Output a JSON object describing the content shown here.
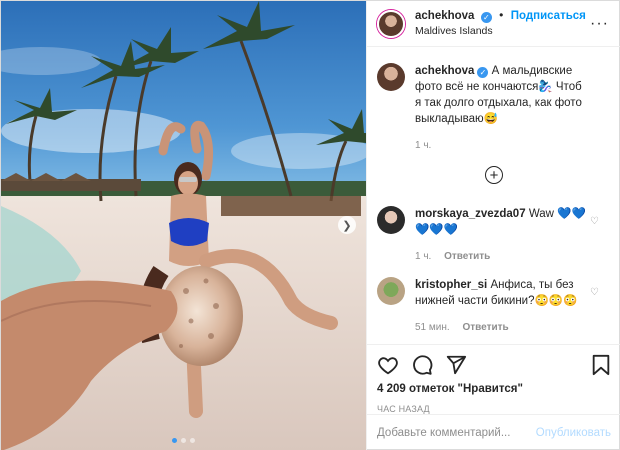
{
  "post": {
    "username": "achekhova",
    "follow_label": "Подписаться",
    "location": "Maldives Islands"
  },
  "caption": {
    "username": "achekhova",
    "text": "А мальдивские фото всё не кончаются🧞‍♀️ Чтоб я так долго отдыхала, как фото выкладываю😅",
    "time": "1 ч."
  },
  "comments": [
    {
      "username": "morskaya_zvezda07",
      "text": "Waw 💙💙💙💙💙",
      "time": "1 ч.",
      "reply_label": "Ответить"
    },
    {
      "username": "kristopher_si",
      "text": "Анфиса, ты без нижней части бикини?😳😳😳",
      "time": "51 мин.",
      "reply_label": "Ответить"
    }
  ],
  "likes_text": "4 209 отметок \"Нравится\"",
  "posted_ago": "час назад",
  "comment_input": {
    "placeholder": "Добавьте комментарий...",
    "publish_label": "Опубликовать"
  },
  "icons": {
    "like": "heart-icon",
    "comment": "comment-icon",
    "share": "share-icon",
    "save": "bookmark-icon",
    "more": "more-icon",
    "load_more": "plus-circle-icon",
    "next": "chevron-right-icon"
  },
  "colors": {
    "link": "#0095f6",
    "verified": "#3897f0",
    "muted": "#8e8e8e"
  },
  "carousel": {
    "slides": 3,
    "active": 1
  }
}
